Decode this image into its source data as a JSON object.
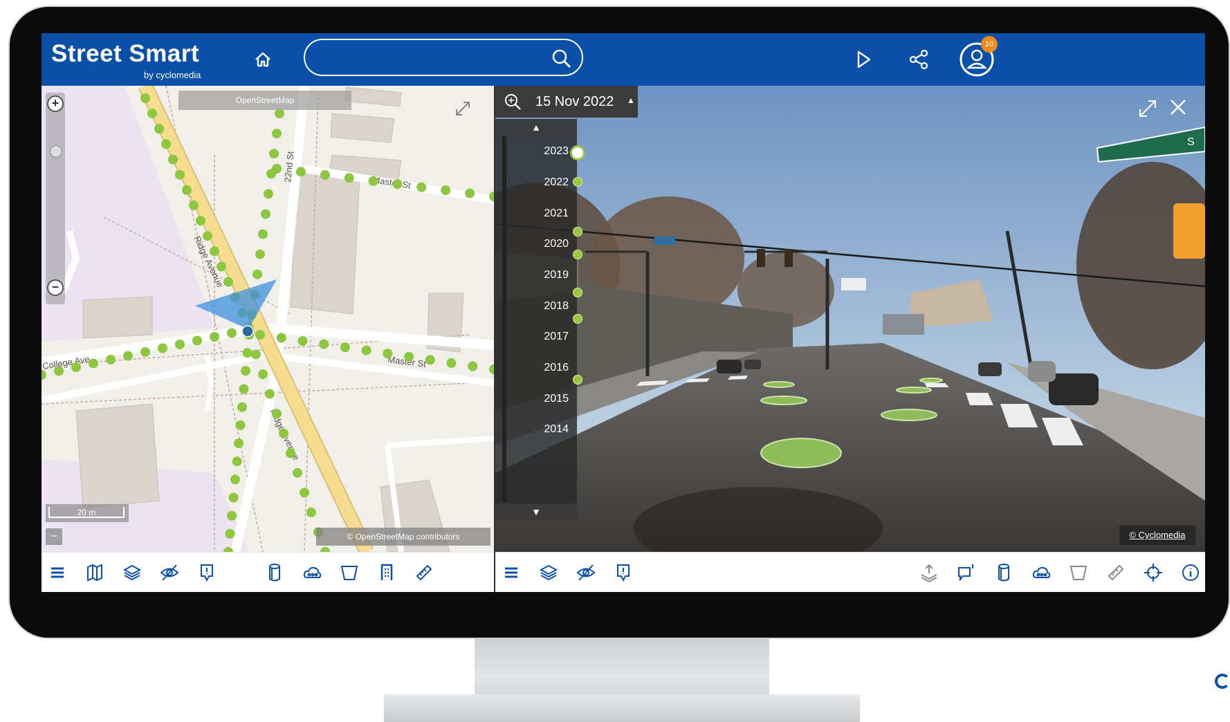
{
  "app": {
    "brand_name": "Street Smart",
    "brand_sub": "by cyclomedia",
    "search_value": "",
    "notification_count": "10",
    "brand_color": "#0a4fa8",
    "header_icons": [
      "home-icon",
      "search-icon",
      "play-icon",
      "share-icon",
      "user-icon"
    ]
  },
  "map": {
    "provider_label": "OpenStreetMap",
    "credit": "© OpenStreetMap contributors",
    "scale": "20 m",
    "street_labels": [
      "Ridge Avenue",
      "Ridge Avenue",
      "Master St",
      "College Ave",
      "22nd St",
      "Master St"
    ],
    "zoom_in": "+",
    "zoom_out": "−",
    "collapse": "–",
    "recording_color": "#8dc63f"
  },
  "streetview": {
    "date": "15 Nov 2022",
    "years": [
      "2023",
      "2022",
      "2021",
      "2020",
      "2019",
      "2018",
      "2017",
      "2016",
      "2015",
      "2014"
    ],
    "credit": "© Cyclomedia",
    "street_sign": "S"
  },
  "toolbar_map": [
    "menu-icon",
    "map-icon",
    "layers-icon",
    "hide-icon",
    "marker-icon",
    "cylinder-icon",
    "cloud-icon",
    "polygon-icon",
    "building-icon",
    "ruler-icon"
  ],
  "toolbar_street": [
    "menu-icon",
    "layers-icon",
    "hide-icon",
    "marker-icon",
    "export-icon",
    "comment-icon",
    "cylinder-icon",
    "cloud-icon",
    "polygon-icon",
    "ruler-icon",
    "locate-icon",
    "info-icon"
  ]
}
